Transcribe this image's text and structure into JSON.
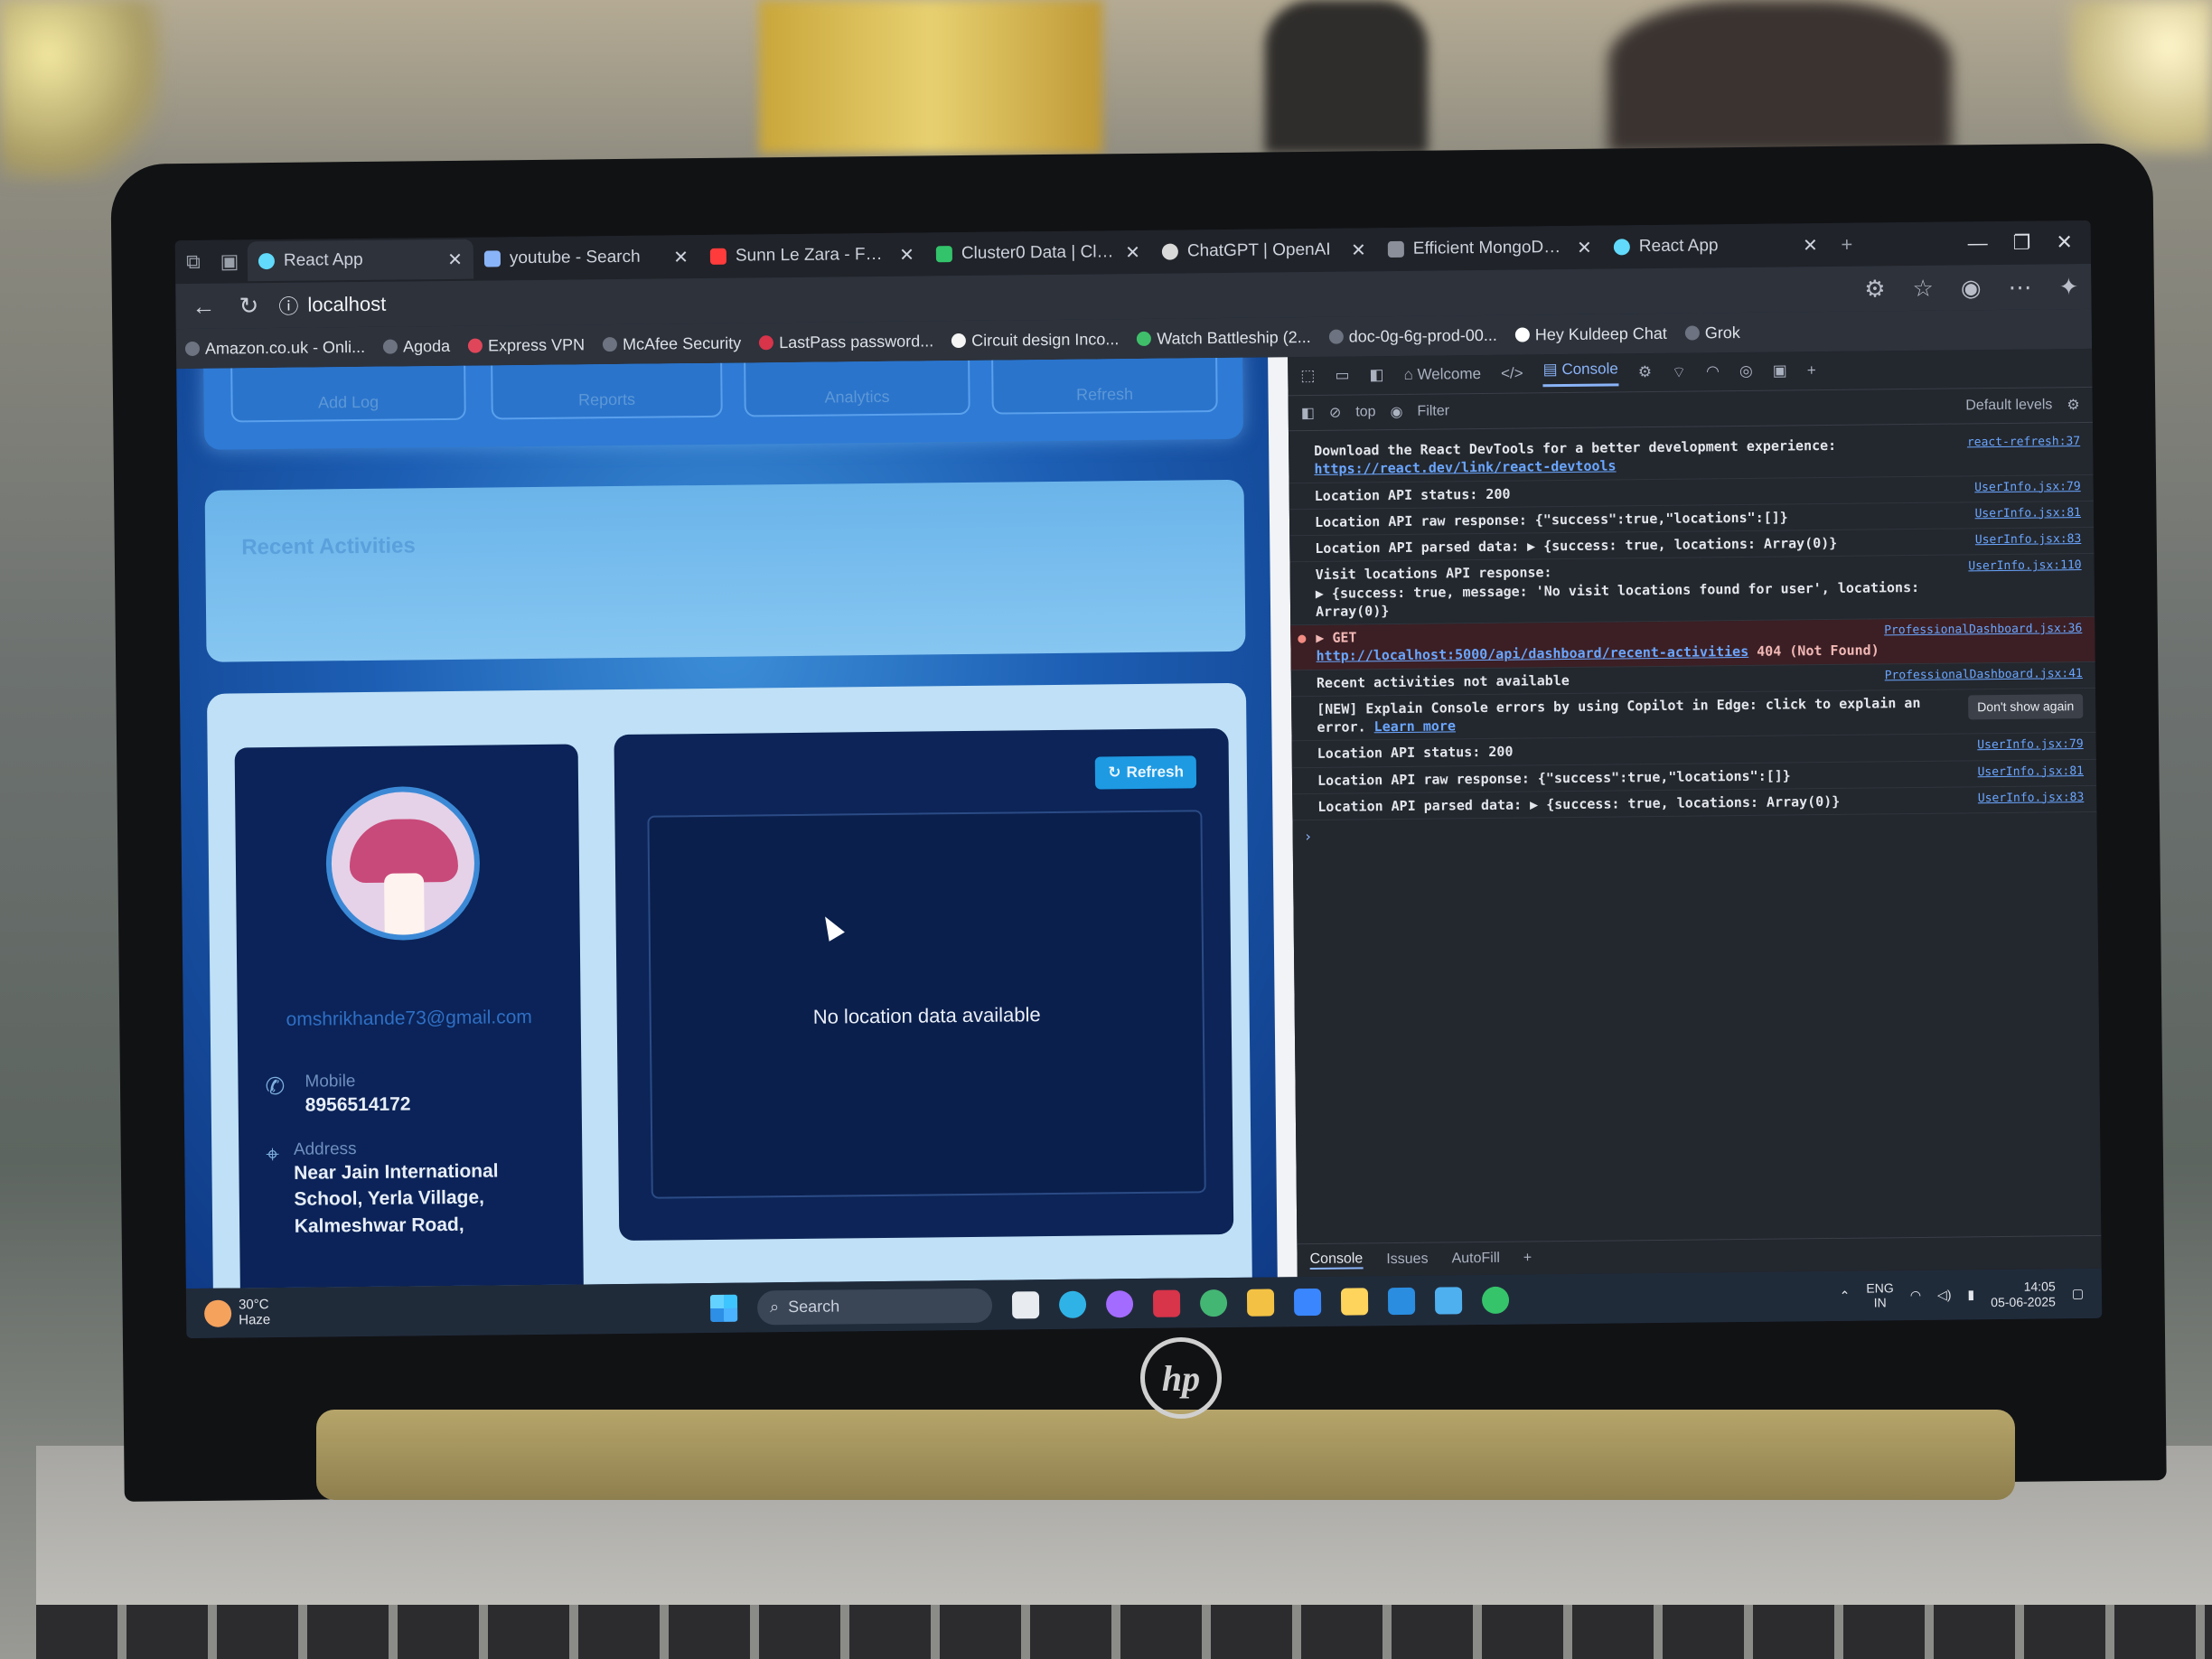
{
  "colors": {
    "accent": "#1e9ae3",
    "devtools_bg": "#23272e",
    "app_bg": "#1d5fb4",
    "card_bg": "#0b2358",
    "error": "#f28b82"
  },
  "browser": {
    "tabs": [
      {
        "label": "React App",
        "icon": "react-icon",
        "color": "#61dafb"
      },
      {
        "label": "youtube - Search",
        "icon": "search-icon",
        "color": "#8ab4f8"
      },
      {
        "label": "Sunn Le Zara - Full V",
        "icon": "youtube-icon",
        "color": "#ff3b3b"
      },
      {
        "label": "Cluster0 Data | Cloud",
        "icon": "mongodb-icon",
        "color": "#33c36b"
      },
      {
        "label": "ChatGPT | OpenAI",
        "icon": "chatgpt-icon",
        "color": "#d9d9d9"
      },
      {
        "label": "Efficient MongoDB D",
        "icon": "page-icon",
        "color": "#8a8f99"
      },
      {
        "label": "React App",
        "icon": "react-icon",
        "color": "#61dafb"
      }
    ],
    "url_host": "localhost",
    "bookmarks": [
      "Amazon.co.uk - Onli...",
      "Agoda",
      "Express VPN",
      "McAfee Security",
      "LastPass password...",
      "Circuit design Inco...",
      "Watch Battleship (2...",
      "doc-0g-6g-prod-00...",
      "Hey Kuldeep Chat",
      "Grok"
    ]
  },
  "app": {
    "quick_actions": [
      "Add Log",
      "Reports",
      "Analytics",
      "Refresh"
    ],
    "recent_title": "Recent Activities",
    "profile": {
      "email": "omshrikhande73@gmail.com",
      "mobile_label": "Mobile",
      "mobile_value": "8956514172",
      "address_label": "Address",
      "address_value": "Near Jain International School, Yerla Village, Kalmeshwar Road,"
    },
    "map": {
      "refresh_label": "Refresh",
      "empty_message": "No location data available"
    }
  },
  "devtools": {
    "tabs": [
      "Welcome",
      "Console"
    ],
    "active_tab": "Console",
    "context": "top",
    "filter_placeholder": "Filter",
    "levels": "Default levels",
    "logs": [
      {
        "text": "Download the React DevTools for a better development experience:",
        "link": "https://react.dev/link/react-devtools",
        "src": "react-refresh:37",
        "type": "info"
      },
      {
        "text": "Location API status: 200",
        "src": "UserInfo.jsx:79",
        "type": "info"
      },
      {
        "text": "Location API raw response: {\"success\":true,\"locations\":[]}",
        "src": "UserInfo.jsx:81",
        "type": "info"
      },
      {
        "text": "Location API parsed data: ▶ {success: true, locations: Array(0)}",
        "src": "UserInfo.jsx:83",
        "type": "info"
      },
      {
        "text": "Visit locations API response:",
        "detail": "▶ {success: true, message: 'No visit locations found for user', locations: Array(0)}",
        "src": "UserInfo.jsx:110",
        "type": "info"
      },
      {
        "text": "▶ GET",
        "link": "http://localhost:5000/api/dashboard/recent-activities",
        "status": "404 (Not Found)",
        "src": "ProfessionalDashboard.jsx:36",
        "type": "error"
      },
      {
        "text": "Recent activities not available",
        "src": "ProfessionalDashboard.jsx:41",
        "type": "info"
      },
      {
        "text": "[NEW] Explain Console errors by using Copilot in Edge: click to explain an error.",
        "link": "Learn more",
        "button": "Don't show again",
        "type": "tip"
      },
      {
        "text": "Location API status: 200",
        "src": "UserInfo.jsx:79",
        "type": "info"
      },
      {
        "text": "Location API raw response: {\"success\":true,\"locations\":[]}",
        "src": "UserInfo.jsx:81",
        "type": "info"
      },
      {
        "text": "Location API parsed data: ▶ {success: true, locations: Array(0)}",
        "src": "UserInfo.jsx:83",
        "type": "info"
      }
    ],
    "drawer_tabs": [
      "Console",
      "Issues",
      "AutoFill"
    ]
  },
  "taskbar": {
    "temperature": "30°C",
    "weather_text": "Haze",
    "search_placeholder": "Search",
    "language": "ENG",
    "region": "IN",
    "time": "14:05",
    "date": "05-06-2025"
  },
  "device": {
    "brand": "hp"
  }
}
